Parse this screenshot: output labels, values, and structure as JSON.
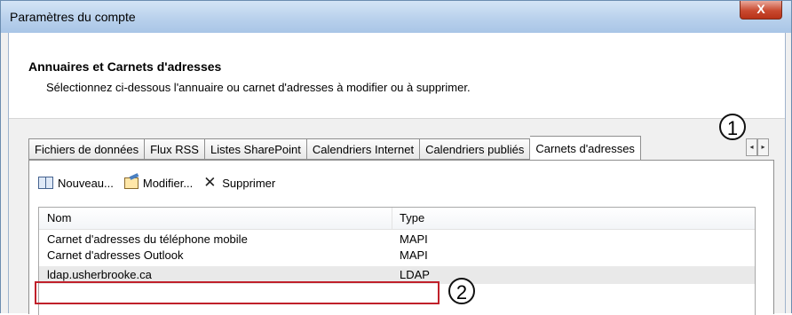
{
  "window": {
    "title": "Paramètres du compte",
    "close_glyph": "X"
  },
  "header": {
    "title": "Annuaires et Carnets d'adresses",
    "subtitle": "Sélectionnez ci-dessous l'annuaire ou carnet d'adresses à modifier ou à supprimer."
  },
  "tabs": [
    {
      "label": "Fichiers de données"
    },
    {
      "label": "Flux RSS"
    },
    {
      "label": "Listes SharePoint"
    },
    {
      "label": "Calendriers Internet"
    },
    {
      "label": "Calendriers publiés"
    },
    {
      "label": "Carnets d'adresses",
      "active": true
    }
  ],
  "tab_scroll": {
    "left": "◂",
    "right": "▸"
  },
  "toolbar": {
    "new_label": "Nouveau...",
    "edit_label": "Modifier...",
    "delete_label": "Supprimer"
  },
  "list": {
    "columns": {
      "name": "Nom",
      "type": "Type"
    },
    "rows": [
      {
        "name": "Carnet d'adresses du téléphone mobile",
        "type": "MAPI"
      },
      {
        "name": "Carnet d'adresses Outlook",
        "type": "MAPI"
      },
      {
        "name": "ldap.usherbrooke.ca",
        "type": "LDAP",
        "selected": true
      }
    ]
  },
  "annotations": {
    "callout_1": "1",
    "callout_2": "2",
    "highlight_color": "#c0202a"
  }
}
